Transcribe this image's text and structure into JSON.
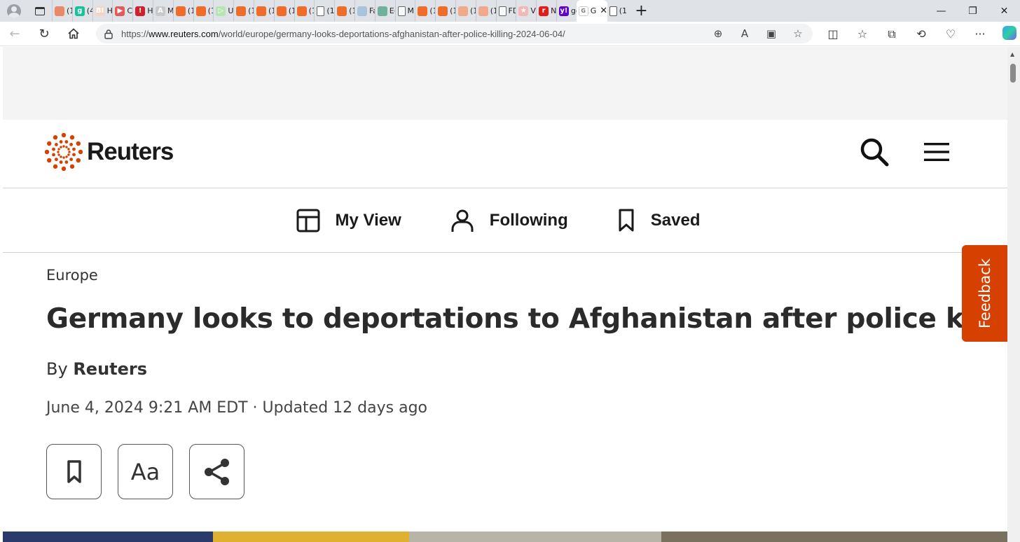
{
  "browser": {
    "tabs": [
      {
        "label": "(1",
        "color": "#e8896a",
        "glyph": ""
      },
      {
        "label": "(4",
        "color": "#15c39a",
        "glyph": "g"
      },
      {
        "label": "H",
        "color": "#f3d5c8",
        "glyph": "BI"
      },
      {
        "label": "Ca",
        "color": "#e25a5a",
        "glyph": "▶"
      },
      {
        "label": "H",
        "color": "#d41f2a",
        "glyph": "!"
      },
      {
        "label": "M",
        "color": "#c9c9c9",
        "glyph": "A"
      },
      {
        "label": "(1",
        "color": "#f06c2b",
        "glyph": ""
      },
      {
        "label": "(1",
        "color": "#f06c2b",
        "glyph": ""
      },
      {
        "label": "U!",
        "color": "#b7e4b0",
        "glyph": "▷"
      },
      {
        "label": "(1",
        "color": "#f06c2b",
        "glyph": ""
      },
      {
        "label": "(1",
        "color": "#f06c2b",
        "glyph": ""
      },
      {
        "label": "(1",
        "color": "#f06c2b",
        "glyph": ""
      },
      {
        "label": "(1",
        "color": "#f06c2b",
        "glyph": ""
      },
      {
        "label": "(1",
        "color": "#ffffff",
        "glyph": ""
      },
      {
        "label": "(1",
        "color": "#f06c2b",
        "glyph": ""
      },
      {
        "label": "Fa",
        "color": "#a9c4d8",
        "glyph": ""
      },
      {
        "label": "E(",
        "color": "#6fb19a",
        "glyph": ""
      },
      {
        "label": "M",
        "color": "#ffffff",
        "glyph": ""
      },
      {
        "label": "(1",
        "color": "#f06c2b",
        "glyph": ""
      },
      {
        "label": "(1",
        "color": "#f06c2b",
        "glyph": ""
      },
      {
        "label": "(1",
        "color": "#f0a98a",
        "glyph": ""
      },
      {
        "label": "(1",
        "color": "#f0a98a",
        "glyph": ""
      },
      {
        "label": "FD",
        "color": "#ffffff",
        "glyph": ""
      },
      {
        "label": "Vi",
        "color": "#f2b8b8",
        "glyph": "★"
      },
      {
        "label": "N",
        "color": "#e21b1b",
        "glyph": "r"
      },
      {
        "label": "ge",
        "color": "#5f01d1",
        "glyph": "y!"
      }
    ],
    "active_tab": {
      "label": "G"
    },
    "last_tab": {
      "label": "(1"
    },
    "url_prefix": "https://",
    "url_domain": "www.reuters.com",
    "url_path": "/world/europe/germany-looks-deportations-afghanistan-after-police-killing-2024-06-04/"
  },
  "site": {
    "logo_text": "Reuters",
    "brand_color": "#d64000",
    "nav": {
      "my_view": "My View",
      "following": "Following",
      "saved": "Saved"
    },
    "feedback_label": "Feedback"
  },
  "article": {
    "section": "Europe",
    "headline": "Germany looks to deportations to Afghanistan after police killing",
    "by_prefix": "By",
    "author": "Reuters",
    "dateline": "June 4, 2024 9:21 AM EDT · Updated 12 days ago",
    "text_size_label": "Aa"
  }
}
